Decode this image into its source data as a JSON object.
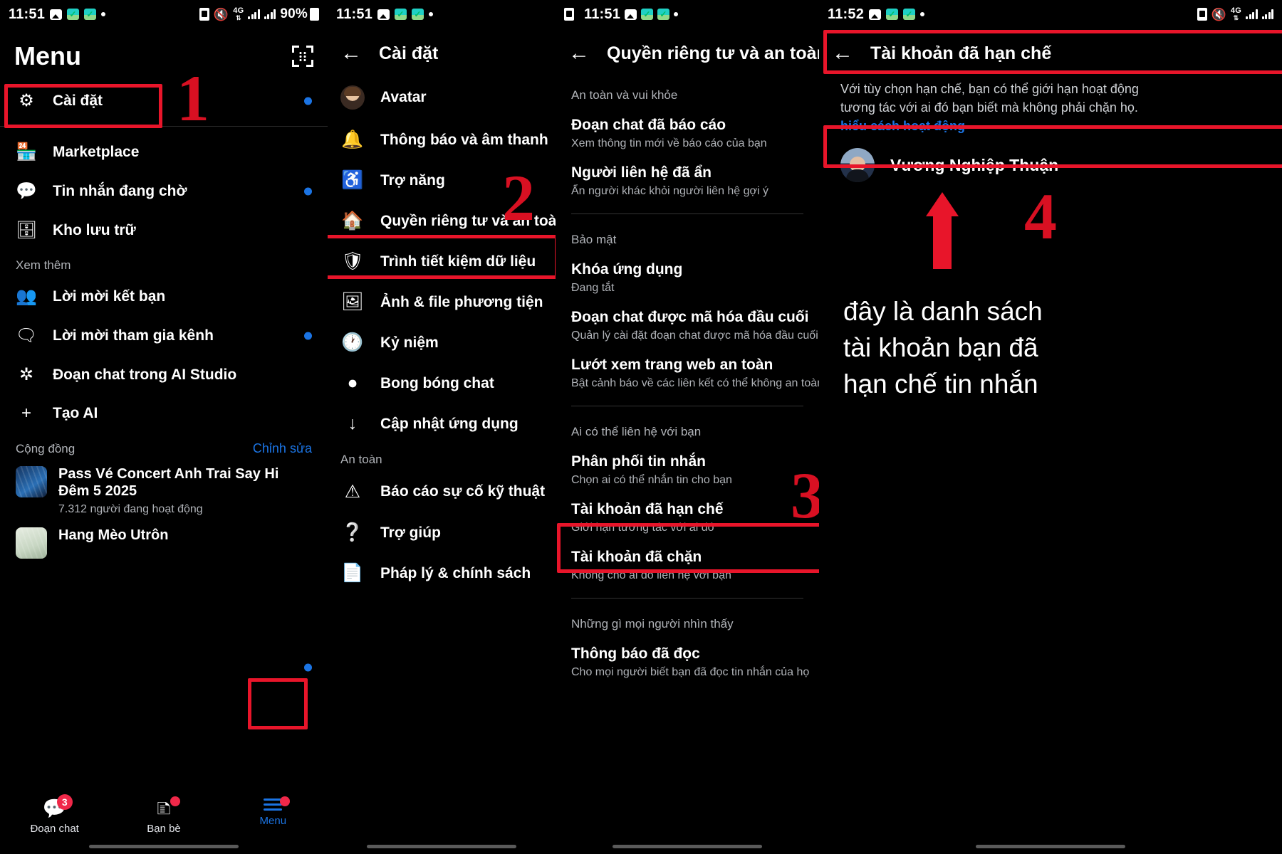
{
  "panel1": {
    "status": {
      "time": "11:51",
      "battery": "90%",
      "icons": [
        "photo-icon",
        "green-check-icon",
        "green-check-icon",
        "dot-icon"
      ],
      "right_icons": [
        "sim-icon",
        "mute-icon",
        "4g-icon",
        "signal-icon",
        "signal-icon"
      ]
    },
    "title": "Menu",
    "qr_icon": "qr-scan-icon",
    "settings_item": {
      "label": "Cài đặt",
      "icon": "gear-icon",
      "has_badge": true
    },
    "items": [
      {
        "label": "Marketplace",
        "icon": "store-icon",
        "has_badge": false
      },
      {
        "label": "Tin nhắn đang chờ",
        "icon": "chat-dots-icon",
        "has_badge": true
      },
      {
        "label": "Kho lưu trữ",
        "icon": "archive-icon",
        "has_badge": false
      }
    ],
    "more_header": "Xem thêm",
    "more_items": [
      {
        "label": "Lời mời kết bạn",
        "icon": "people-icon",
        "has_badge": false
      },
      {
        "label": "Lời mời tham gia kênh",
        "icon": "channel-icon",
        "has_badge": true
      },
      {
        "label": "Đoạn chat trong AI Studio",
        "icon": "ai-studio-icon",
        "has_badge": false
      },
      {
        "label": "Tạo AI",
        "icon": "plus-icon",
        "has_badge": false
      }
    ],
    "community_header": "Cộng đồng",
    "community_edit": "Chỉnh sửa",
    "communities": [
      {
        "title": "Pass Vé Concert Anh Trai Say Hi Đêm 5 2025",
        "subtitle": "7.312 người đang hoạt động"
      },
      {
        "title": "Hang Mèo Utrôn",
        "subtitle": ""
      }
    ],
    "tabs": [
      {
        "label": "Đoạn chat",
        "icon": "chat-bubble-icon",
        "badge": "3",
        "active": false
      },
      {
        "label": "Bạn bè",
        "icon": "friends-icon",
        "badge": "",
        "active": false
      },
      {
        "label": "Menu",
        "icon": "hamburger-icon",
        "badge": "",
        "active": true
      }
    ],
    "annotation_number": "1"
  },
  "panel2": {
    "status": {
      "time": "11:51"
    },
    "title": "Cài đặt",
    "back_icon": "back-arrow-icon",
    "items": [
      {
        "label": "Avatar",
        "icon": "avatar-photo-icon",
        "has_badge": true
      },
      {
        "label": "Thông báo và âm thanh",
        "icon": "bell-icon",
        "has_badge": false
      },
      {
        "label": "Trợ năng",
        "icon": "accessibility-icon",
        "has_badge": true
      },
      {
        "label": "Quyền riêng tư và an toàn",
        "icon": "privacy-lock-house-icon",
        "has_badge": false
      },
      {
        "label": "Trình tiết kiệm dữ liệu",
        "icon": "data-saver-shield-icon",
        "has_badge": false
      },
      {
        "label": "Ảnh & file phương tiện",
        "icon": "media-image-icon",
        "has_badge": false
      },
      {
        "label": "Kỷ niệm",
        "icon": "memories-clock-icon",
        "has_badge": true
      },
      {
        "label": "Bong bóng chat",
        "icon": "chat-bubbles-icon",
        "has_badge": false
      },
      {
        "label": "Cập nhật ứng dụng",
        "icon": "download-icon",
        "has_badge": false
      }
    ],
    "safety_header": "An toàn",
    "safety_items": [
      {
        "label": "Báo cáo sự cố kỹ thuật",
        "icon": "warning-triangle-icon"
      },
      {
        "label": "Trợ giúp",
        "icon": "help-circle-icon"
      },
      {
        "label": "Pháp lý & chính sách",
        "icon": "document-icon"
      }
    ],
    "annotation_number": "2"
  },
  "panel3": {
    "status": {
      "time": "11:51"
    },
    "title": "Quyền riêng tư và an toàn",
    "back_icon": "back-arrow-icon",
    "groups": [
      {
        "header": "An toàn và vui khỏe",
        "items": [
          {
            "title": "Đoạn chat đã báo cáo",
            "subtitle": "Xem thông tin mới về báo cáo của bạn"
          },
          {
            "title": "Người liên hệ đã ẩn",
            "subtitle": "Ẩn người khác khỏi người liên hệ gợi ý"
          }
        ]
      },
      {
        "header": "Bảo mật",
        "items": [
          {
            "title": "Khóa ứng dụng",
            "subtitle": "Đang tắt"
          },
          {
            "title": "Đoạn chat được mã hóa đầu cuối",
            "subtitle": "Quản lý cài đặt đoạn chat được mã hóa đầu cuối"
          },
          {
            "title": "Lướt xem trang web an toàn",
            "subtitle": "Bật cảnh báo về các liên kết có thể không an toàn"
          }
        ]
      },
      {
        "header": "Ai có thể liên hệ với bạn",
        "items": [
          {
            "title": "Phân phối tin nhắn",
            "subtitle": "Chọn ai có thể nhắn tin cho bạn"
          },
          {
            "title": "Tài khoản đã hạn chế",
            "subtitle": "Giới hạn tương tác với ai đó"
          },
          {
            "title": "Tài khoản đã chặn",
            "subtitle": "Không cho ai đó liên hệ với bạn"
          }
        ]
      },
      {
        "header": "Những gì mọi người nhìn thấy",
        "items": [
          {
            "title": "Thông báo đã đọc",
            "subtitle": "Cho mọi người biết bạn đã đọc tin nhắn của họ"
          }
        ]
      }
    ],
    "annotation_number": "3"
  },
  "panel4": {
    "status": {
      "time": "11:52"
    },
    "title": "Tài khoản đã hạn chế",
    "back_icon": "back-arrow-icon",
    "description_line1": "Với tùy chọn hạn chế, bạn có thể giới hạn hoạt động",
    "description_line2": "tương tác với ai đó bạn biết mà không phải chặn họ.",
    "description_link": "hiểu cách hoạt động",
    "person": {
      "name": "Vương Nghiệp Thuận",
      "avatar": "person-avatar"
    },
    "annotation_number": "4",
    "annotation_text_line1": "đây là danh sách",
    "annotation_text_line2": "tài khoản bạn đã",
    "annotation_text_line3": "hạn chế tin nhắn",
    "arrow": "up-arrow-annotation"
  },
  "colors": {
    "accent_blue": "#1b74e4",
    "annotation_red": "#e8152a",
    "badge_red": "#f02849",
    "muted_text": "#b0b3b8"
  }
}
